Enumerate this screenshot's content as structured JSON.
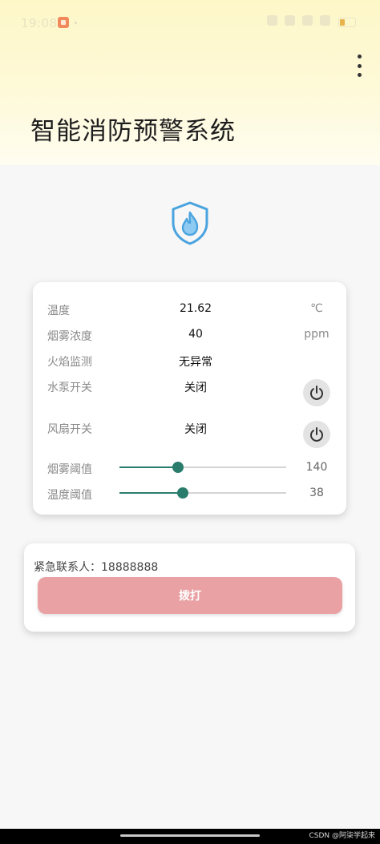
{
  "status_bar": {
    "time": "19:08"
  },
  "app": {
    "title": "智能消防预警系统"
  },
  "icons": {
    "logo": "fire-shield-icon",
    "menu": "more-vert-icon",
    "power": "power-icon"
  },
  "colors": {
    "accent": "#2a7d6c",
    "call_button": "#e9a1a4",
    "logo": "#4aa3df"
  },
  "sensors": [
    {
      "label": "温度",
      "value": "21.62",
      "unit": "℃"
    },
    {
      "label": "烟雾浓度",
      "value": "40",
      "unit": "ppm"
    },
    {
      "label": "火焰监测",
      "value": "无异常",
      "unit": ""
    }
  ],
  "switches": [
    {
      "label": "水泵开关",
      "state": "关闭"
    },
    {
      "label": "风扇开关",
      "state": "关闭"
    }
  ],
  "thresholds": [
    {
      "label": "烟雾阈值",
      "value": "140",
      "slider_fraction": 0.35
    },
    {
      "label": "温度阈值",
      "value": "38",
      "slider_fraction": 0.38
    }
  ],
  "contact": {
    "text": "紧急联系人：18888888",
    "call_label": "拨打"
  },
  "watermark": "CSDN @阿柒学起来"
}
